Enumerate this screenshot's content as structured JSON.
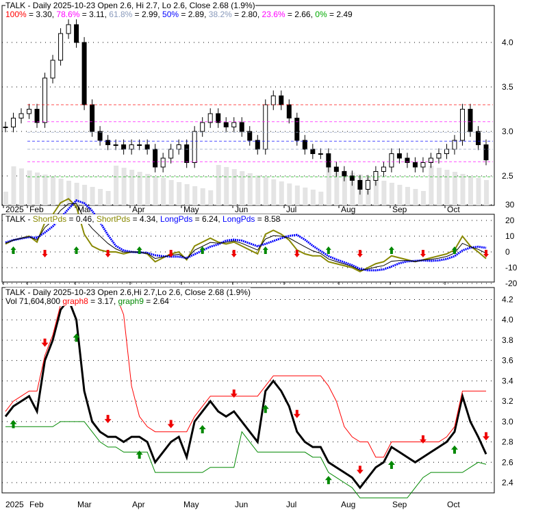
{
  "panel1": {
    "title": "TALK - Daily 2025-10-23 Open 2.6, Hi 2.7, Lo 2.6, Close 2.68 (1.9%)",
    "fib": [
      {
        "label": "100%",
        "value": "3.30",
        "color": "#ff0000"
      },
      {
        "label": "78.6%",
        "value": "3.11",
        "color": "#ff00ff"
      },
      {
        "label": "61.8%",
        "value": "2.99",
        "color": "#8899bb"
      },
      {
        "label": "50%",
        "value": "2.89",
        "color": "#0000ff"
      },
      {
        "label": "38.2%",
        "value": "2.80",
        "color": "#8899bb"
      },
      {
        "label": "23.6%",
        "value": "2.66",
        "color": "#ff00ff"
      },
      {
        "label": "0%",
        "value": "2.49",
        "color": "#00aa00"
      }
    ]
  },
  "panel2": {
    "ticker": "TALK -",
    "items": [
      {
        "label": "ShortPds",
        "value": "0.46",
        "color": "#888800"
      },
      {
        "label": "ShortPds",
        "value": "4.34",
        "color": "#888800"
      },
      {
        "label": "LongPds",
        "value": "6.24",
        "color": "#0000ff"
      },
      {
        "label": "LongPds",
        "value": "8.58",
        "color": "#0000ff"
      }
    ]
  },
  "panel3": {
    "title": "TALK - Daily 2025-10-23 Open 2.6,Hi 2.7,Lo 2.6, Close 2.68 (1.9%)",
    "vol": "Vol 71,604,800",
    "g8": "graph8",
    "g8v": "3.17",
    "g9": "graph9",
    "g9v": "2.64"
  },
  "chart_data": {
    "type": "line",
    "title": "TALK - Daily",
    "months": [
      "2025",
      "Feb",
      "Mar",
      "Apr",
      "May",
      "Jun",
      "Jul",
      "Aug",
      "Sep",
      "Oct"
    ],
    "price_ticks": [
      "2.5",
      "3.0",
      "3.5",
      "4.0"
    ],
    "osc_ticks": [
      "30",
      "20",
      "10",
      "0",
      "-10",
      "-20"
    ],
    "close_ticks": [
      "2.4",
      "2.6",
      "2.8",
      "3.0",
      "3.2",
      "3.4",
      "3.6",
      "3.8",
      "4.0",
      "4.2"
    ],
    "closes": [
      3.05,
      3.15,
      3.2,
      3.25,
      3.1,
      3.6,
      3.8,
      4.1,
      4.2,
      4.0,
      3.3,
      3.0,
      2.9,
      2.85,
      2.85,
      2.8,
      2.85,
      2.85,
      2.8,
      2.6,
      2.7,
      2.8,
      2.85,
      2.65,
      3.0,
      3.1,
      3.2,
      3.1,
      3.05,
      3.1,
      3.0,
      2.9,
      2.8,
      3.3,
      3.4,
      3.3,
      3.15,
      2.9,
      2.8,
      2.75,
      2.75,
      2.6,
      2.55,
      2.5,
      2.45,
      2.35,
      2.45,
      2.55,
      2.6,
      2.75,
      2.7,
      2.65,
      2.6,
      2.65,
      2.7,
      2.75,
      2.8,
      2.9,
      3.25,
      3.0,
      2.85,
      2.68
    ]
  }
}
